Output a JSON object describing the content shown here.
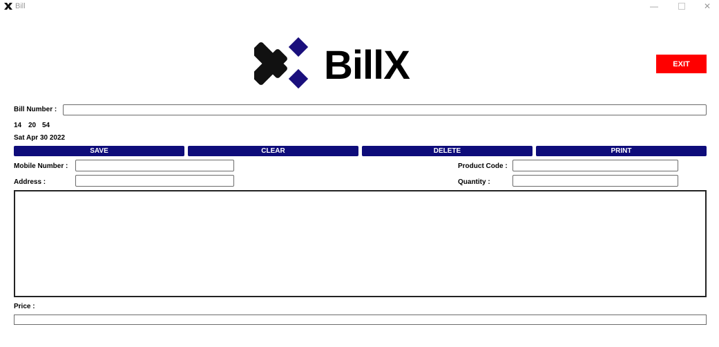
{
  "window": {
    "title": "Bill",
    "controls": {
      "minimize": "—",
      "close": "✕"
    }
  },
  "logo": {
    "text": "BillX",
    "icon": "billx-logo-icon"
  },
  "buttons": {
    "exit": "EXIT",
    "save": "SAVE",
    "clear": "CLEAR",
    "delete": "DELETE",
    "print": "PRINT"
  },
  "labels": {
    "bill_number": "Bill Number :",
    "mobile_number": "Mobile Number :",
    "address": "Address :",
    "product_code": "Product Code :",
    "quantity": "Quantity :",
    "price": "Price :"
  },
  "clock": {
    "hour": "14",
    "minute": "20",
    "second": "54"
  },
  "date": "Sat Apr 30 2022",
  "fields": {
    "bill_number": "",
    "mobile_number": "",
    "address": "",
    "product_code": "",
    "quantity": "",
    "bill_details": "",
    "price": ""
  },
  "colors": {
    "action_button": "#0e0c7a",
    "exit_button": "#ff0000",
    "logo_accent": "#1a0f7c",
    "logo_dark": "#111111"
  }
}
